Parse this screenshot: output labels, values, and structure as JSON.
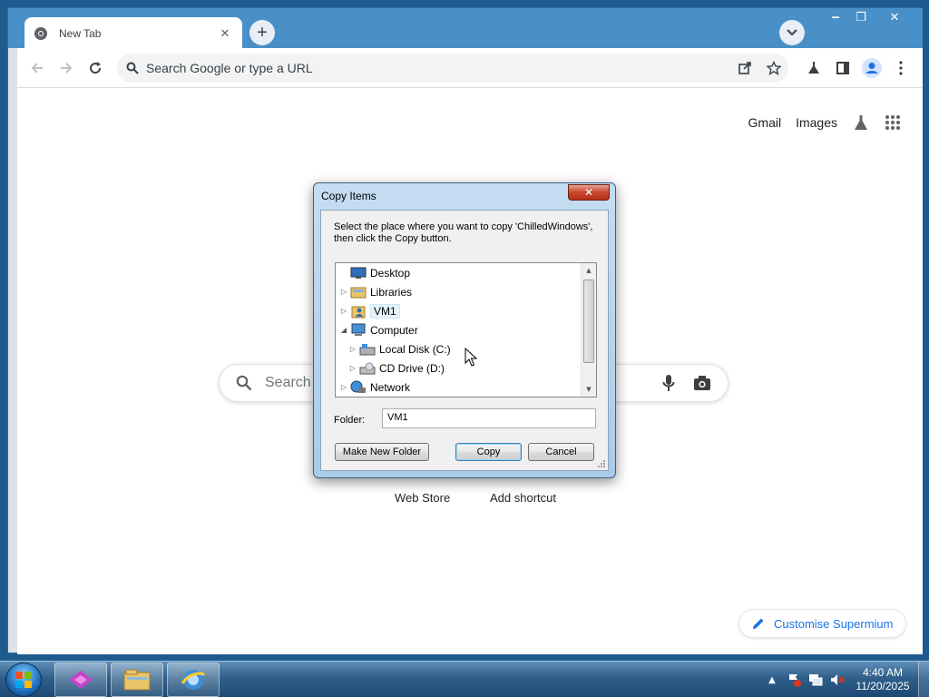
{
  "browser": {
    "tab_title": "New Tab",
    "tab_close": "✕",
    "new_tab": "+",
    "omnibox_placeholder": "Search Google or type a URL",
    "window_controls": {
      "minimize": "‒",
      "maximize": "❐",
      "close": "✕"
    }
  },
  "ntp": {
    "links": {
      "gmail": "Gmail",
      "images": "Images"
    },
    "search_placeholder": "Search Google or type a URL",
    "search_visible_text": "Search G",
    "shortcuts": [
      "Web Store",
      "Add shortcut"
    ],
    "customise": "Customise Supermium"
  },
  "dialog": {
    "title": "Copy Items",
    "close": "✕",
    "message": "Select the place where you want to copy 'ChilledWindows', then click the Copy button.",
    "tree": [
      {
        "label": "Desktop",
        "icon": "desktop-icon",
        "expander": "",
        "selected": false
      },
      {
        "label": "Libraries",
        "icon": "libraries-icon",
        "expander": "▷",
        "selected": false
      },
      {
        "label": "VM1",
        "icon": "user-folder-icon",
        "expander": "▷",
        "selected": true
      },
      {
        "label": "Computer",
        "icon": "computer-icon",
        "expander": "◢",
        "selected": false
      },
      {
        "label": "Local Disk (C:)",
        "icon": "hard-disk-icon",
        "expander": "▷",
        "selected": false
      },
      {
        "label": "CD Drive (D:)",
        "icon": "cd-drive-icon",
        "expander": "▷",
        "selected": false
      },
      {
        "label": "Network",
        "icon": "network-icon",
        "expander": "▷",
        "selected": false
      }
    ],
    "folder_label": "Folder:",
    "folder_value": "VM1",
    "buttons": {
      "new_folder": "Make New Folder",
      "copy": "Copy",
      "cancel": "Cancel"
    }
  },
  "taskbar": {
    "apps": [
      "start-orb",
      "supermium-app-icon",
      "file-explorer-icon",
      "internet-explorer-icon"
    ],
    "tray_chevron": "▲",
    "time": "4:40 AM",
    "date": "11/20/2025"
  },
  "colors": {
    "accent": "#1a73e8",
    "tabstrip": "#4a90c8",
    "taskbar": "#2f5f8a",
    "dialog_frame": "#aacbe9"
  }
}
